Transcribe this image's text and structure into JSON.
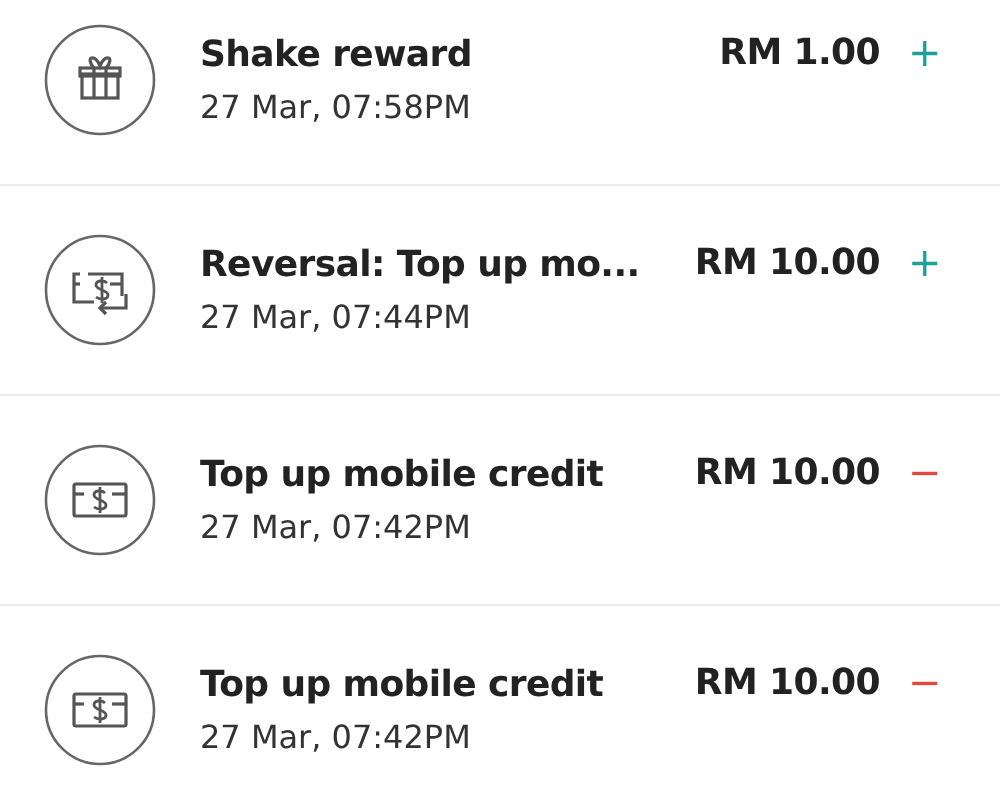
{
  "transactions": [
    {
      "kind": "reward",
      "title": "Shake reward",
      "date": "27 Mar, 07:58PM",
      "amount": "RM 1.00",
      "sign": "+",
      "credit": true
    },
    {
      "kind": "reversal",
      "title": "Reversal: Top up mo...",
      "date": "27 Mar, 07:44PM",
      "amount": "RM 10.00",
      "sign": "+",
      "credit": true
    },
    {
      "kind": "topup",
      "title": "Top up mobile credit",
      "date": "27 Mar, 07:42PM",
      "amount": "RM 10.00",
      "sign": "−",
      "credit": false
    },
    {
      "kind": "topup",
      "title": "Top up mobile credit",
      "date": "27 Mar, 07:42PM",
      "amount": "RM 10.00",
      "sign": "−",
      "credit": false
    }
  ]
}
